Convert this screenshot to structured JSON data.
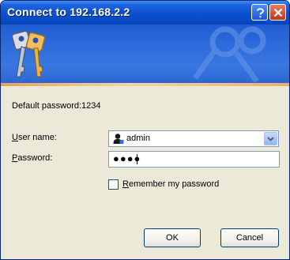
{
  "window": {
    "title": "Connect to 192.168.2.2"
  },
  "dialog": {
    "default_password_text": "Default password:1234",
    "username_label_mnemonic": "U",
    "username_label_rest": "ser name:",
    "username_value": "admin",
    "password_label_mnemonic": "P",
    "password_label_rest": "assword:",
    "password_value": "●●●●",
    "remember_label_mnemonic": "R",
    "remember_label_rest": "emember my password",
    "remember_checked": false,
    "ok_label": "OK",
    "cancel_label": "Cancel"
  },
  "icons": {
    "help": "question-mark-icon",
    "close": "close-x-icon",
    "banner": "keys-icon",
    "user": "user-account-icon",
    "dropdown": "chevron-down-icon"
  },
  "colors": {
    "titlebar": "#0b4fcf",
    "banner": "#2f6ddc",
    "close_button": "#c2351a",
    "dialog_background": "#ece9d8",
    "input_border": "#7f9db9"
  }
}
